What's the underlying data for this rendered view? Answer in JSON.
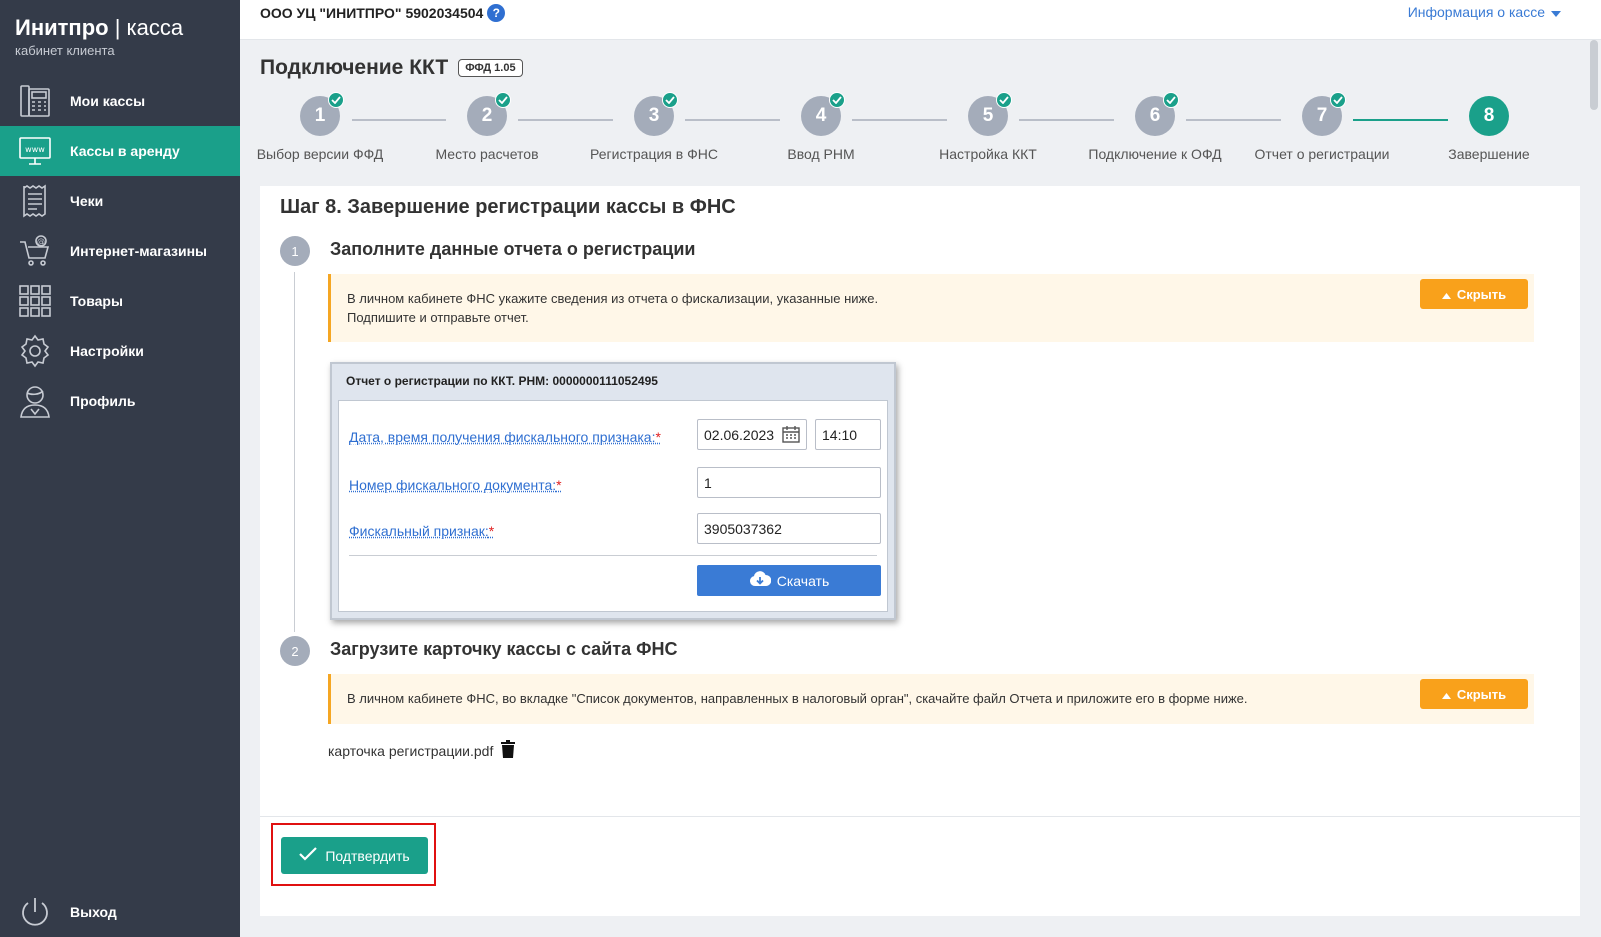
{
  "brand": {
    "name": "Инитпро",
    "separator": "|",
    "product": "касса",
    "subtitle": "кабинет клиента"
  },
  "nav": {
    "items": [
      {
        "label": "Мои кассы",
        "icon": "cash-register-icon",
        "active": false
      },
      {
        "label": "Кассы в аренду",
        "icon": "www-monitor-icon",
        "active": true
      },
      {
        "label": "Чеки",
        "icon": "receipt-icon",
        "active": false
      },
      {
        "label": "Интернет-магазины",
        "icon": "online-cart-icon",
        "active": false
      },
      {
        "label": "Товары",
        "icon": "grid-icon",
        "active": false
      },
      {
        "label": "Настройки",
        "icon": "gear-icon",
        "active": false
      },
      {
        "label": "Профиль",
        "icon": "user-icon",
        "active": false
      }
    ],
    "logout": "Выход"
  },
  "topbar": {
    "org": "ООО УЦ \"ИНИТПРО\" 5902034504",
    "info_link": "Информация о кассе"
  },
  "header": {
    "title": "Подключение ККТ",
    "badge": "ФФД 1.05"
  },
  "stepper": {
    "steps": [
      {
        "num": "1",
        "label": "Выбор версии ФФД",
        "done": true
      },
      {
        "num": "2",
        "label": "Место расчетов",
        "done": true
      },
      {
        "num": "3",
        "label": "Регистрация в ФНС",
        "done": true
      },
      {
        "num": "4",
        "label": "Ввод РНМ",
        "done": true
      },
      {
        "num": "5",
        "label": "Настройка ККТ",
        "done": true
      },
      {
        "num": "6",
        "label": "Подключение к ОФД",
        "done": true
      },
      {
        "num": "7",
        "label": "Отчет о регистрации",
        "done": true
      },
      {
        "num": "8",
        "label": "Завершение",
        "done": false
      }
    ]
  },
  "main": {
    "title": "Шаг 8. Завершение регистрации кассы в ФНС",
    "section1": {
      "num": "1",
      "title": "Заполните данные отчета о регистрации",
      "note_line1": "В личном кабинете ФНС укажите сведения из отчета о фискализации, указанные ниже.",
      "note_line2": "Подпишите и отправьте отчет.",
      "hide_label": "Скрыть"
    },
    "report": {
      "header": "Отчет о регистрации по ККТ. РНМ: 0000000111052495",
      "date_label": "Дата, время получения фискального признака:",
      "date_value": "02.06.2023",
      "time_value": "14:10",
      "doc_label": "Номер фискального документа:",
      "doc_value": "1",
      "sign_label": "Фискальный признак:",
      "sign_value": "3905037362",
      "required_mark": "*",
      "download_label": "Скачать"
    },
    "section2": {
      "num": "2",
      "title": "Загрузите карточку кассы с сайта ФНС",
      "note": "В личном кабинете ФНС, во вкладке \"Список документов, направленных в налоговый орган\", скачайте файл Отчета и приложите его в форме ниже.",
      "hide_label": "Скрыть",
      "file_name": "карточка регистрации.pdf"
    },
    "confirm_label": "Подтвердить"
  },
  "colors": {
    "sidebar": "#343b49",
    "accent": "#1aa08a",
    "link": "#3a7bd5",
    "warning": "#f9a11b",
    "highlight": "#e01010"
  }
}
